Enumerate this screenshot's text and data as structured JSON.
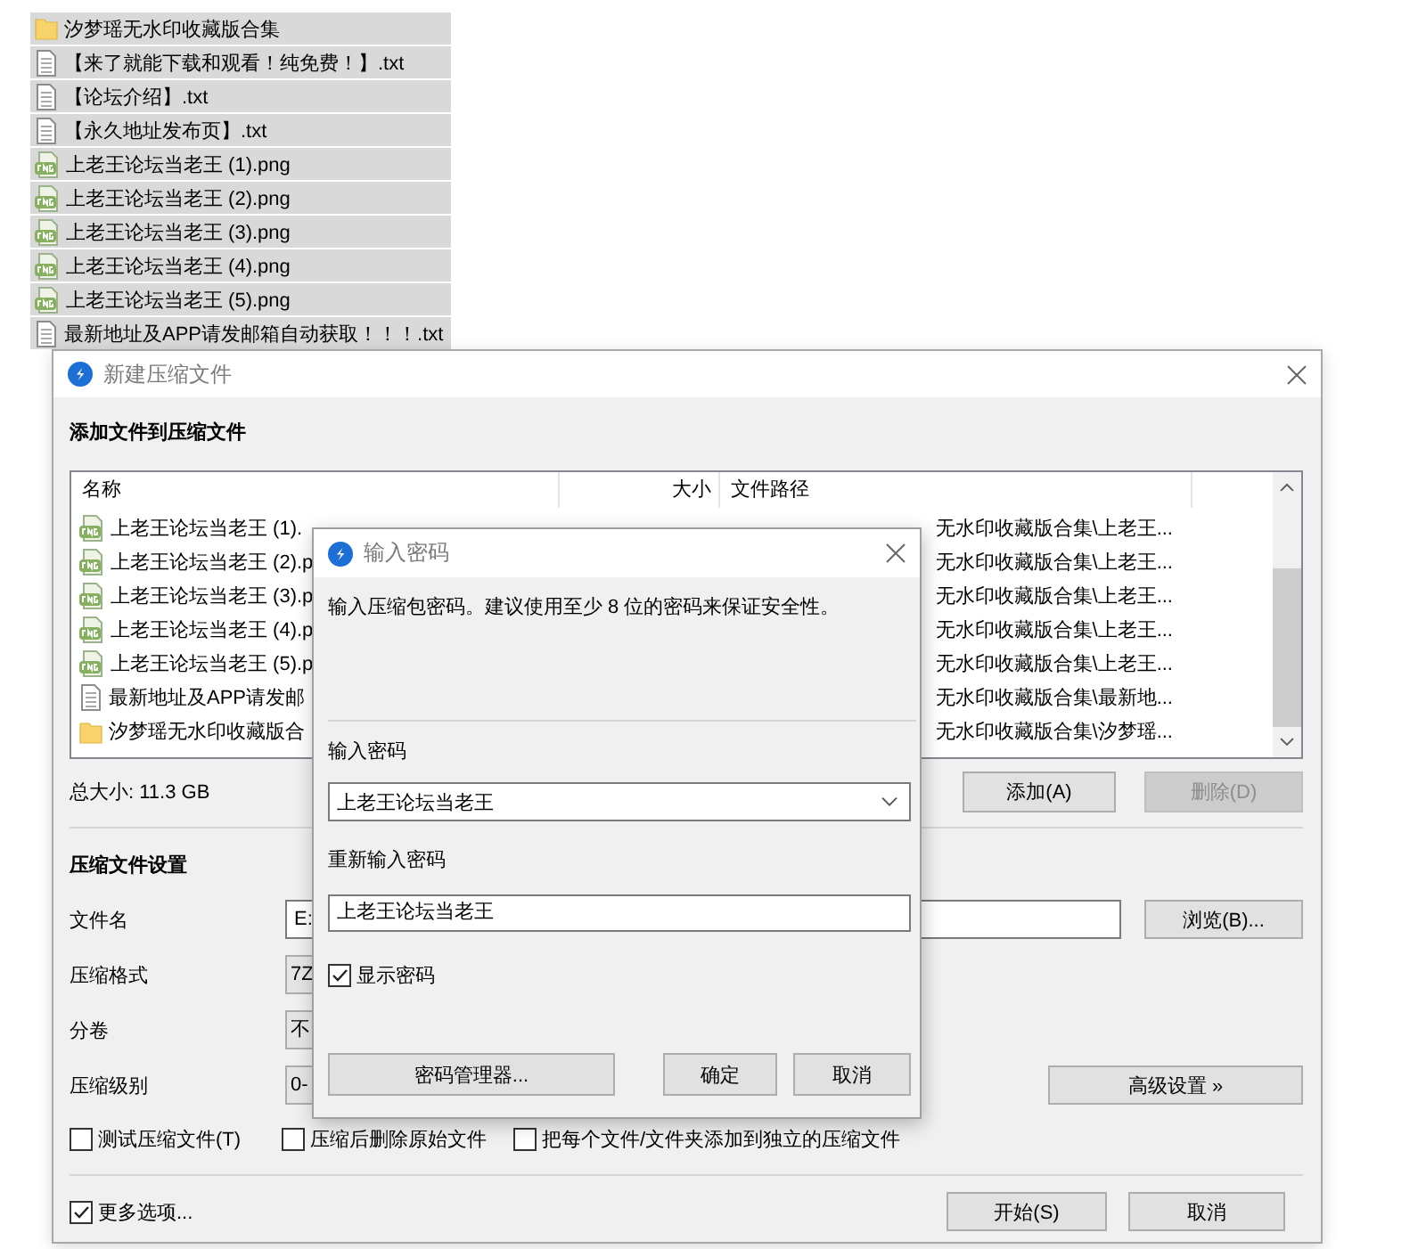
{
  "explorer_items": [
    {
      "kind": "folder",
      "name": "汐梦瑶无水印收藏版合集"
    },
    {
      "kind": "text",
      "name": "【来了就能下载和观看！纯免费！】.txt"
    },
    {
      "kind": "text",
      "name": "【论坛介绍】.txt"
    },
    {
      "kind": "text",
      "name": "【永久地址发布页】.txt"
    },
    {
      "kind": "image",
      "name": "上老王论坛当老王 (1).png"
    },
    {
      "kind": "image",
      "name": "上老王论坛当老王 (2).png"
    },
    {
      "kind": "image",
      "name": "上老王论坛当老王 (3).png"
    },
    {
      "kind": "image",
      "name": "上老王论坛当老王 (4).png"
    },
    {
      "kind": "image",
      "name": "上老王论坛当老王 (5).png"
    },
    {
      "kind": "text",
      "name": "最新地址及APP请发邮箱自动获取！！！.txt"
    }
  ],
  "main_dialog": {
    "title": "新建压缩文件",
    "section_title": "添加文件到压缩文件",
    "columns": [
      "名称",
      "大小",
      "文件路径"
    ],
    "rows": [
      {
        "kind": "image",
        "name": "上老王论坛当老王 (1).",
        "path": "无水印收藏版合集\\上老王..."
      },
      {
        "kind": "image",
        "name": "上老王论坛当老王 (2).p",
        "path": "无水印收藏版合集\\上老王..."
      },
      {
        "kind": "image",
        "name": "上老王论坛当老王 (3).p",
        "path": "无水印收藏版合集\\上老王..."
      },
      {
        "kind": "image",
        "name": "上老王论坛当老王 (4).p",
        "path": "无水印收藏版合集\\上老王..."
      },
      {
        "kind": "image",
        "name": "上老王论坛当老王 (5).p",
        "path": "无水印收藏版合集\\上老王..."
      },
      {
        "kind": "text",
        "name": "最新地址及APP请发邮",
        "path": "无水印收藏版合集\\最新地..."
      },
      {
        "kind": "folder",
        "name": "汐梦瑶无水印收藏版合",
        "path": "无水印收藏版合集\\汐梦瑶..."
      }
    ],
    "total_size": "总大小: 11.3 GB",
    "add_button": "添加(A)",
    "delete_button": {
      "label": "删除(D)",
      "disabled": true
    },
    "settings_title": "压缩文件设置",
    "fields": [
      {
        "label": "文件名",
        "kind": "text",
        "value": "E:",
        "button": "浏览(B)..."
      },
      {
        "label": "压缩格式",
        "kind": "dropdown",
        "value": "7Z"
      },
      {
        "label": "分卷",
        "kind": "dropdown",
        "value": "不"
      },
      {
        "label": "压缩级别",
        "kind": "dropdown",
        "value": "0-",
        "button": "高级设置 »"
      }
    ],
    "options": [
      {
        "label": "测试压缩文件(T)",
        "checked": false
      },
      {
        "label": "压缩后删除原始文件",
        "checked": false
      },
      {
        "label": "把每个文件/文件夹添加到独立的压缩文件",
        "checked": false
      }
    ],
    "more_options": {
      "label": "更多选项...",
      "checked": true
    },
    "buttons": [
      "开始(S)",
      "取消"
    ]
  },
  "password_dialog": {
    "title": "输入密码",
    "message": "输入压缩包密码。建议使用至少 8 位的密码来保证安全性。",
    "password_label": "输入密码",
    "password": "上老王论坛当老王",
    "confirm_label": "重新输入密码",
    "confirm": "上老王论坛当老王",
    "show_password": {
      "label": "显示密码",
      "checked": true
    },
    "buttons": [
      "密码管理器...",
      "确定",
      "取消"
    ]
  }
}
